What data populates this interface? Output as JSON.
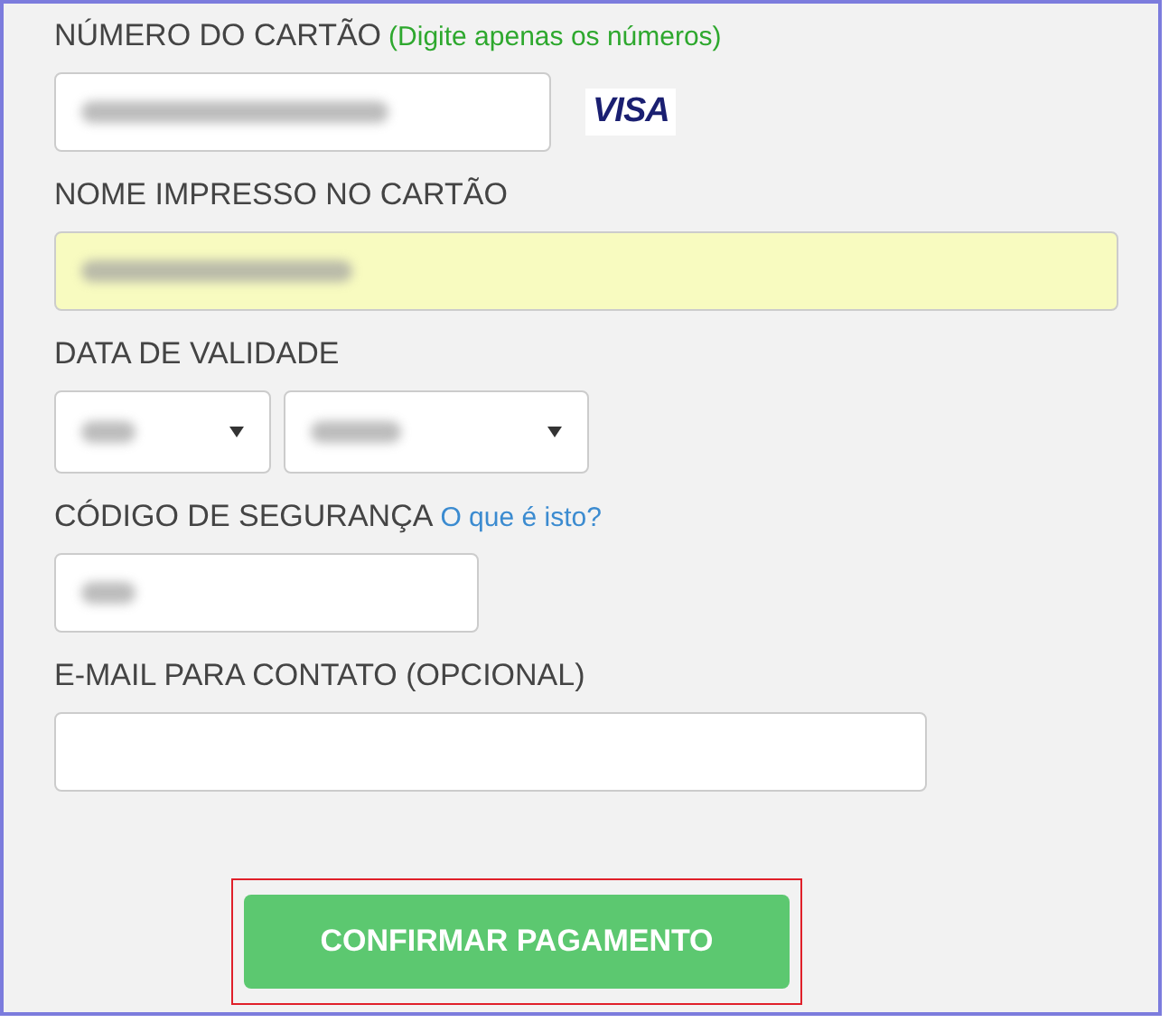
{
  "card_number": {
    "label": "NÚMERO DO CARTÃO",
    "hint": "(Digite apenas os números)",
    "brand": "VISA",
    "value_hidden": true
  },
  "name_on_card": {
    "label": "NOME IMPRESSO NO CARTÃO",
    "value_hidden": true,
    "highlighted": true
  },
  "expiry": {
    "label": "DATA DE VALIDADE",
    "selects": [
      {
        "value_hidden": true
      },
      {
        "value_hidden": true
      }
    ]
  },
  "security_code": {
    "label": "CÓDIGO DE SEGURANÇA",
    "help_link": "O que é isto?",
    "value_hidden": true
  },
  "email": {
    "label": "E-MAIL PARA CONTATO (OPCIONAL)",
    "value_hidden": false
  },
  "confirm_button": {
    "label": "CONFIRMAR PAGAMENTO",
    "outlined": true
  }
}
